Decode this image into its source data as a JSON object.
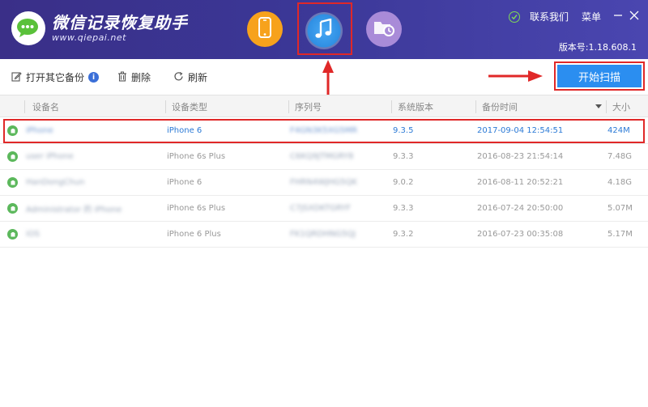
{
  "app": {
    "title": "微信记录恢复助手",
    "url": "www.qiepai.net",
    "version": "版本号:1.18.608.1"
  },
  "header": {
    "links": {
      "contact": "联系我们",
      "menu": "菜单"
    },
    "modes": [
      "iphone-icon",
      "itunes-music-icon",
      "folder-clock-icon"
    ],
    "selected_mode": "itunes-music-icon"
  },
  "toolbar": {
    "open_backup": "打开其它备份",
    "delete": "删除",
    "refresh": "刷新",
    "start_scan": "开始扫描"
  },
  "table": {
    "columns": [
      "设备名",
      "设备类型",
      "序列号",
      "系统版本",
      "备份时间",
      "大小"
    ],
    "sorted_column": "备份时间",
    "rows": [
      {
        "name": "iPhone",
        "type": "iPhone 6",
        "serial": "F4GN3K5XG5MR",
        "version": "9.3.5",
        "time": "2017-09-04 12:54:51",
        "size": "424M",
        "selected": true
      },
      {
        "name": "user iPhone",
        "type": "iPhone 6s Plus",
        "serial": "C6KQ9JTMGRY8",
        "version": "9.3.3",
        "time": "2016-08-23 21:54:14",
        "size": "7.48G",
        "selected": false
      },
      {
        "name": "HanDongChun",
        "type": "iPhone 6",
        "serial": "FHRN4WJHG5QK",
        "version": "9.0.2",
        "time": "2016-08-11 20:52:21",
        "size": "4.18G",
        "selected": false
      },
      {
        "name": "Administrator 的 iPhone",
        "type": "iPhone 6s Plus",
        "serial": "C7JSXDKTGRYF",
        "version": "9.3.3",
        "time": "2016-07-24 20:50:00",
        "size": "5.07M",
        "selected": false
      },
      {
        "name": "iOS",
        "type": "iPhone 6 Plus",
        "serial": "FK1QRDHNG5QJ",
        "version": "9.3.2",
        "time": "2016-07-23 00:35:08",
        "size": "5.17M",
        "selected": false
      }
    ]
  },
  "colors": {
    "header_bg": "#3b3796",
    "accent": "#2b8ef0",
    "highlight": "#e02828",
    "selected_text": "#2b7ad6",
    "device_icon": "#5cb85c"
  }
}
